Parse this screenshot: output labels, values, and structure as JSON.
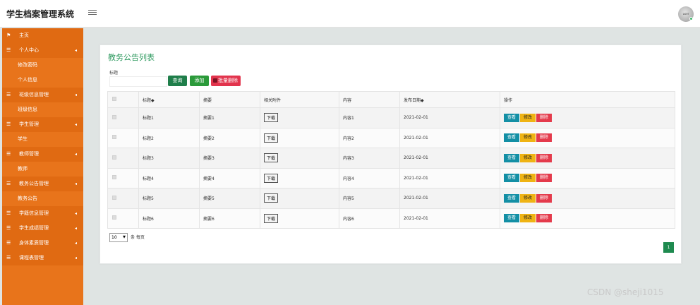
{
  "app": {
    "title": "学生档案管理系统"
  },
  "sidebar": {
    "items": [
      {
        "label": "主页",
        "type": "home"
      },
      {
        "label": "个人中心",
        "type": "group"
      },
      {
        "label": "修改密码",
        "type": "sub"
      },
      {
        "label": "个人信息",
        "type": "sub"
      },
      {
        "label": "班级信息管理",
        "type": "group"
      },
      {
        "label": "班级信息",
        "type": "sub"
      },
      {
        "label": "学生管理",
        "type": "group"
      },
      {
        "label": "学生",
        "type": "sub"
      },
      {
        "label": "教师管理",
        "type": "group"
      },
      {
        "label": "教师",
        "type": "sub"
      },
      {
        "label": "教务公告管理",
        "type": "group"
      },
      {
        "label": "教务公告",
        "type": "sub"
      },
      {
        "label": "学籍信息管理",
        "type": "group"
      },
      {
        "label": "学生成绩管理",
        "type": "group"
      },
      {
        "label": "身体素质管理",
        "type": "group"
      },
      {
        "label": "课程表管理",
        "type": "group"
      }
    ]
  },
  "main": {
    "title": "教务公告列表",
    "filter_label": "标题",
    "filter_value": "",
    "buttons": {
      "search": "查询",
      "add": "添加",
      "batch_delete": "批量删除"
    },
    "columns": [
      "",
      "标题◆",
      "摘要",
      "相关附件",
      "内容",
      "发布日期◆",
      "操作"
    ],
    "rows": [
      {
        "title": "标题1",
        "summary": "摘要1",
        "attachment": "下载",
        "content": "内容1",
        "date": "2021-02-01"
      },
      {
        "title": "标题2",
        "summary": "摘要2",
        "attachment": "下载",
        "content": "内容2",
        "date": "2021-02-01"
      },
      {
        "title": "标题3",
        "summary": "摘要3",
        "attachment": "下载",
        "content": "内容3",
        "date": "2021-02-01"
      },
      {
        "title": "标题4",
        "summary": "摘要4",
        "attachment": "下载",
        "content": "内容4",
        "date": "2021-02-01"
      },
      {
        "title": "标题5",
        "summary": "摘要5",
        "attachment": "下载",
        "content": "内容5",
        "date": "2021-02-01"
      },
      {
        "title": "标题6",
        "summary": "摘要6",
        "attachment": "下载",
        "content": "内容6",
        "date": "2021-02-01"
      }
    ],
    "actions": {
      "view": "查看",
      "edit": "修改",
      "delete": "删除"
    },
    "page_size": "10",
    "per_page_label": "条 每页",
    "current_page": "1"
  },
  "watermark": "CSDN @sheji1015"
}
